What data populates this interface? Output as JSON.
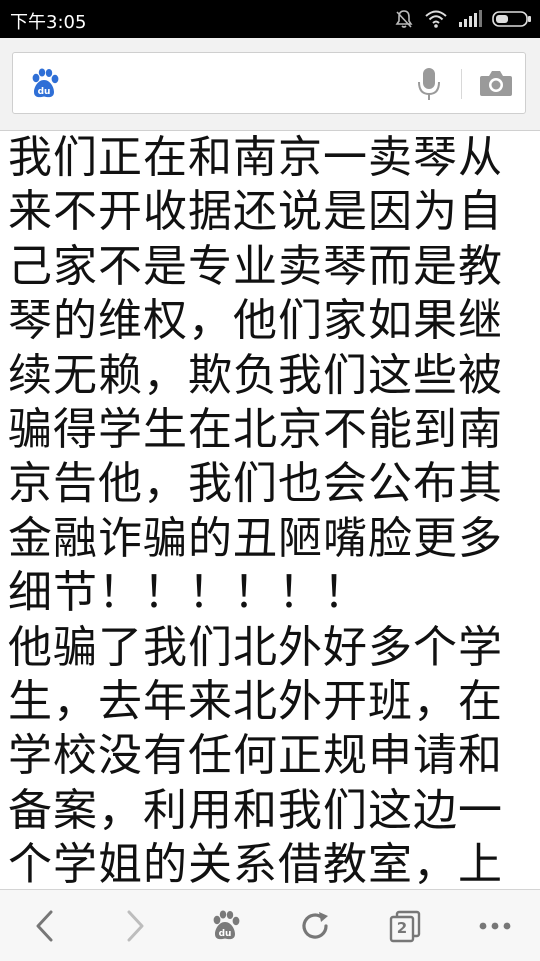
{
  "status_bar": {
    "time": "下午3:05",
    "icons": [
      "mute-icon",
      "wifi-icon",
      "signal-icon",
      "battery-icon"
    ]
  },
  "search": {
    "logo": "baidu-paw-logo",
    "value": "",
    "placeholder": "",
    "mic_icon": "microphone-icon",
    "camera_icon": "camera-icon"
  },
  "article": {
    "lines": [
      "我们正在和南京一卖琴从",
      "来不开收据还说是因为自",
      "己家不是专业卖琴而是教",
      "琴的维权，他们家如果继",
      "续无赖，欺负我们这些被",
      "骗得学生在北京不能到南",
      "京告他，我们也会公布其",
      "金融诈骗的丑陋嘴脸更多",
      "细节！！！！！！",
      "他骗了我们北外好多个学",
      "生，去年来北外开班，在",
      "学校没有任何正规申请和",
      "备案，利用和我们这边一",
      "个学姐的关系借教室，上"
    ]
  },
  "toolbar": {
    "back": "back-icon",
    "forward": "forward-icon",
    "home": "baidu-home-icon",
    "refresh": "refresh-icon",
    "tabs": "tabs-icon",
    "tabs_count": "2",
    "menu": "more-icon"
  },
  "colors": {
    "baidu_blue": "#2f6fd6",
    "icon_gray": "#8a8a8a"
  }
}
